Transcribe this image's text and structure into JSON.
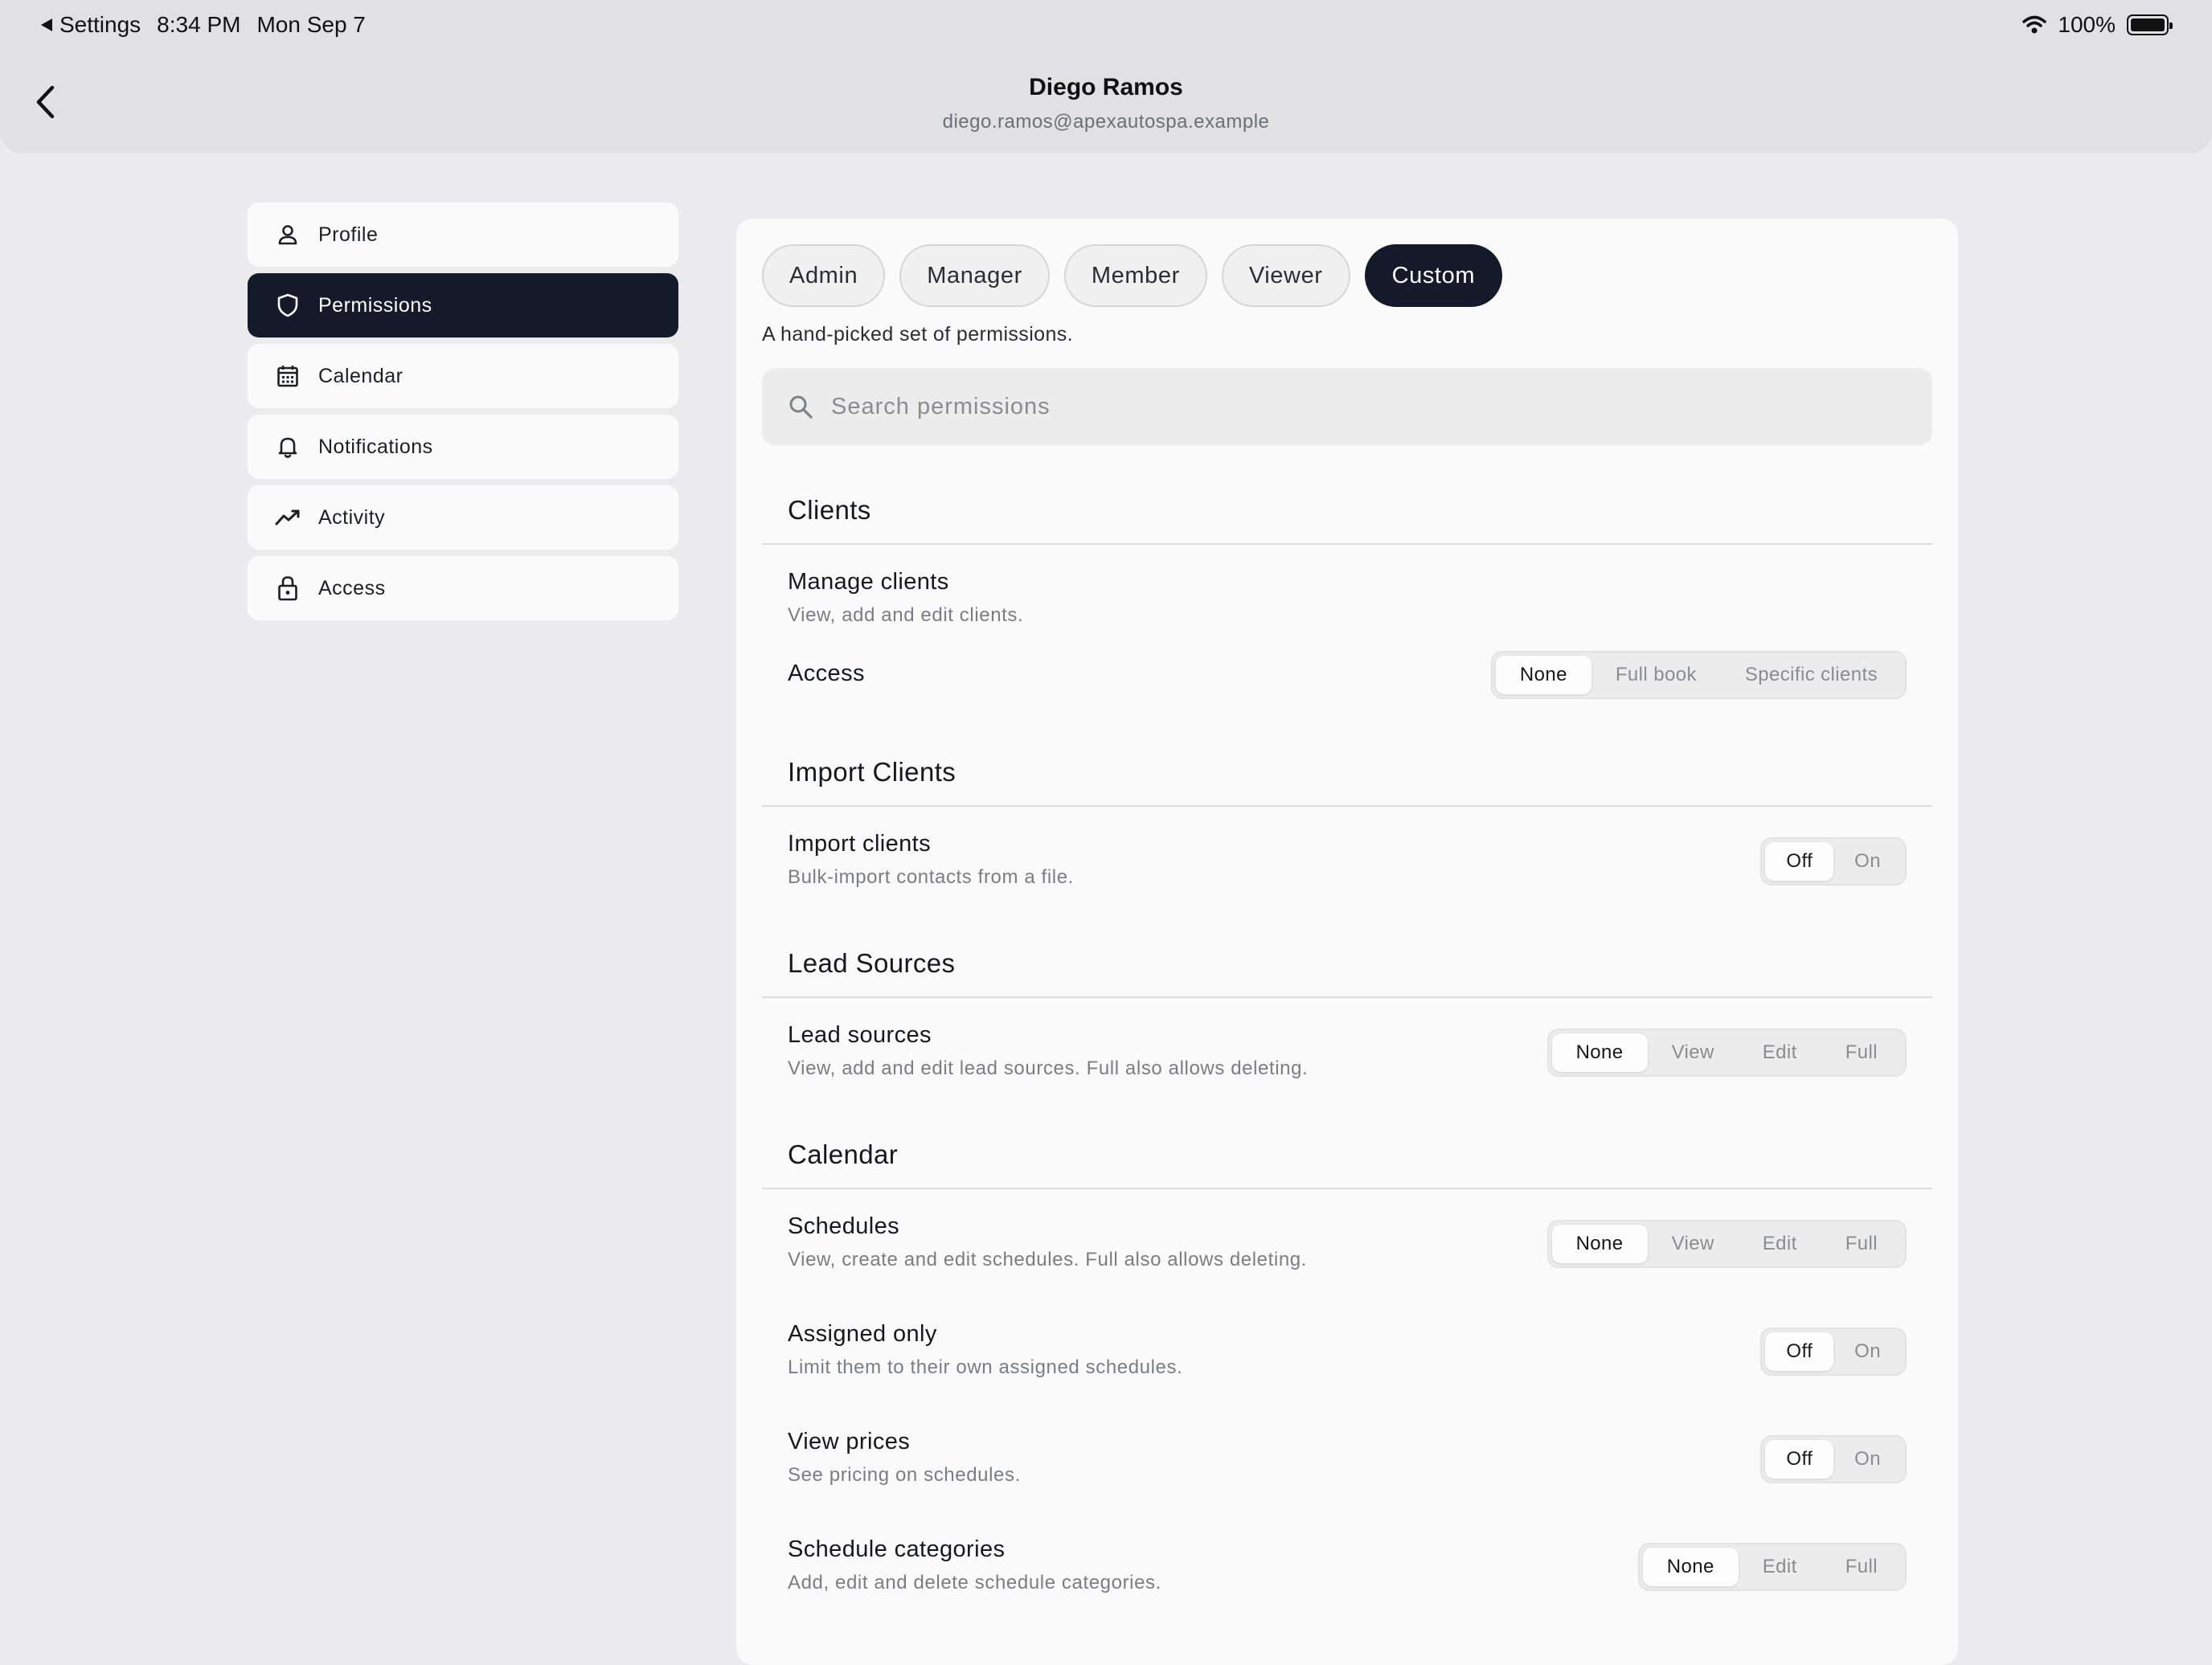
{
  "status": {
    "back_app": "Settings",
    "time": "8:34 PM",
    "date": "Mon Sep 7",
    "battery": "100%"
  },
  "header": {
    "name": "Diego Ramos",
    "email": "diego.ramos@apexautospa.example"
  },
  "sidebar": {
    "items": [
      {
        "label": "Profile",
        "icon": "person-icon"
      },
      {
        "label": "Permissions",
        "icon": "shield-icon"
      },
      {
        "label": "Calendar",
        "icon": "calendar-icon"
      },
      {
        "label": "Notifications",
        "icon": "bell-icon"
      },
      {
        "label": "Activity",
        "icon": "activity-icon"
      },
      {
        "label": "Access",
        "icon": "lock-icon"
      }
    ],
    "selected": "Permissions"
  },
  "roles": {
    "options": [
      "Admin",
      "Manager",
      "Member",
      "Viewer",
      "Custom"
    ],
    "selected": "Custom",
    "description": "A hand-picked set of permissions."
  },
  "search": {
    "placeholder": "Search permissions",
    "value": ""
  },
  "sections": {
    "clients": {
      "title": "Clients",
      "manage": {
        "title": "Manage clients",
        "desc": "View, add and edit clients.",
        "access_label": "Access",
        "options": [
          "None",
          "Full book",
          "Specific clients"
        ],
        "selected": "None"
      }
    },
    "import_clients": {
      "title": "Import Clients",
      "import": {
        "title": "Import clients",
        "desc": "Bulk-import contacts from a file.",
        "options": [
          "Off",
          "On"
        ],
        "selected": "Off"
      }
    },
    "lead_sources": {
      "title": "Lead Sources",
      "lead": {
        "title": "Lead sources",
        "desc": "View, add and edit lead sources. Full also allows deleting.",
        "options": [
          "None",
          "View",
          "Edit",
          "Full"
        ],
        "selected": "None"
      }
    },
    "calendar": {
      "title": "Calendar",
      "schedules": {
        "title": "Schedules",
        "desc": "View, create and edit schedules. Full also allows deleting.",
        "options": [
          "None",
          "View",
          "Edit",
          "Full"
        ],
        "selected": "None"
      },
      "assigned": {
        "title": "Assigned only",
        "desc": "Limit them to their own assigned schedules.",
        "options": [
          "Off",
          "On"
        ],
        "selected": "Off"
      },
      "prices": {
        "title": "View prices",
        "desc": "See pricing on schedules.",
        "options": [
          "Off",
          "On"
        ],
        "selected": "Off"
      },
      "categories": {
        "title": "Schedule categories",
        "desc": "Add, edit and delete schedule categories.",
        "options": [
          "None",
          "Edit",
          "Full"
        ],
        "selected": "None"
      }
    }
  }
}
